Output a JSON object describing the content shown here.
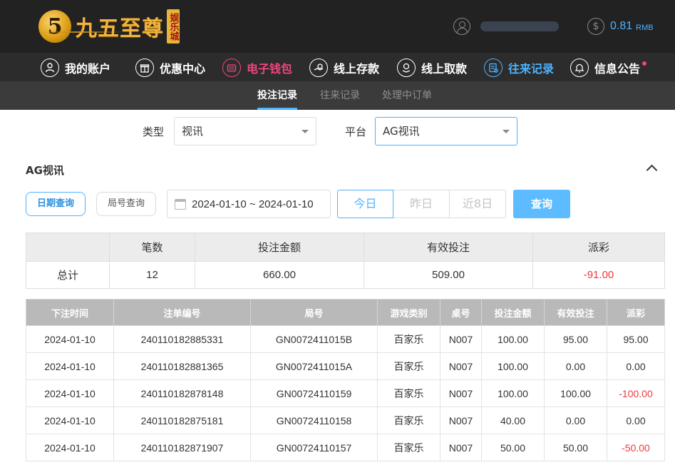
{
  "brand": {
    "logo_mark": "5",
    "name": "九五至尊",
    "badge": "娱乐城"
  },
  "account": {
    "balance": "0.81",
    "currency": "RMB"
  },
  "nav": {
    "items": [
      {
        "label": "我的账户",
        "icon": "user-icon"
      },
      {
        "label": "优惠中心",
        "icon": "gift-icon"
      },
      {
        "label": "电子钱包",
        "icon": "wallet-icon"
      },
      {
        "label": "线上存款",
        "icon": "deposit-icon"
      },
      {
        "label": "线上取款",
        "icon": "withdraw-icon"
      },
      {
        "label": "往来记录",
        "icon": "record-icon"
      },
      {
        "label": "信息公告",
        "icon": "bell-icon"
      }
    ]
  },
  "subnav": {
    "tabs": [
      "投注记录",
      "往来记录",
      "处理中订单"
    ]
  },
  "filters": {
    "type_label": "类型",
    "type_value": "视讯",
    "platform_label": "平台",
    "platform_value": "AG视讯"
  },
  "section": {
    "title": "AG视讯"
  },
  "query": {
    "date_tab": "日期查询",
    "round_tab": "局号查询",
    "date_range": "2024-01-10 ~ 2024-01-10",
    "quick": [
      "今日",
      "昨日",
      "近8日"
    ],
    "submit": "查询"
  },
  "summary": {
    "headers": [
      "",
      "笔数",
      "投注金额",
      "有效投注",
      "派彩"
    ],
    "row": {
      "label": "总计",
      "count": "12",
      "bet": "660.00",
      "valid": "509.00",
      "payout": "-91.00"
    }
  },
  "records": {
    "headers": [
      "下注时间",
      "注单编号",
      "局号",
      "游戏类别",
      "桌号",
      "投注金额",
      "有效投注",
      "派彩"
    ],
    "rows": [
      [
        "2024-01-10",
        "240110182885331",
        "GN0072411015B",
        "百家乐",
        "N007",
        "100.00",
        "95.00",
        "95.00"
      ],
      [
        "2024-01-10",
        "240110182881365",
        "GN0072411015A",
        "百家乐",
        "N007",
        "100.00",
        "0.00",
        "0.00"
      ],
      [
        "2024-01-10",
        "240110182878148",
        "GN00724110159",
        "百家乐",
        "N007",
        "100.00",
        "100.00",
        "-100.00"
      ],
      [
        "2024-01-10",
        "240110182875181",
        "GN00724110158",
        "百家乐",
        "N007",
        "40.00",
        "0.00",
        "0.00"
      ],
      [
        "2024-01-10",
        "240110182871907",
        "GN00724110157",
        "百家乐",
        "N007",
        "50.00",
        "50.00",
        "-50.00"
      ]
    ]
  },
  "colors": {
    "accent": "#4db3ff",
    "wallet_pink": "#f0457d",
    "negative": "#ee3b3b",
    "header_bg": "#222222",
    "gold": "#f2b43c"
  }
}
